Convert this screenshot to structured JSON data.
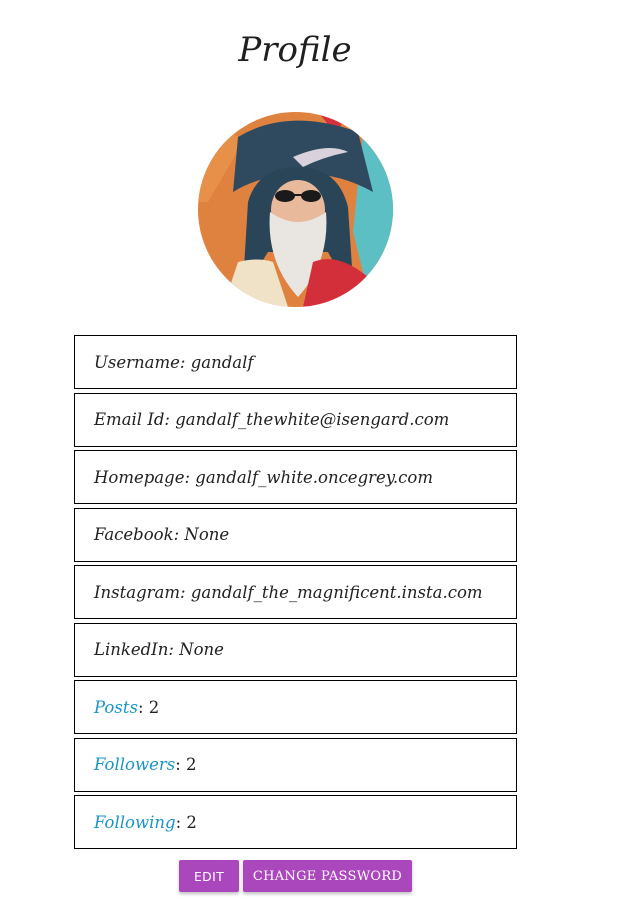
{
  "page": {
    "title": "Profile"
  },
  "avatar": {
    "alt": "gandalf avatar",
    "icon": "wizard-portrait"
  },
  "profile_fields": [
    {
      "label": "Username",
      "value": "gandalf"
    },
    {
      "label": "Email Id",
      "value": "gandalf_thewhite@isengard.com"
    },
    {
      "label": "Homepage",
      "value": "gandalf_white.oncegrey.com"
    },
    {
      "label": "Facebook",
      "value": "None"
    },
    {
      "label": "Instagram",
      "value": "gandalf_the_magnificent.insta.com"
    },
    {
      "label": "LinkedIn",
      "value": "None"
    }
  ],
  "stats": [
    {
      "label": "Posts",
      "value": "2"
    },
    {
      "label": "Followers",
      "value": "2"
    },
    {
      "label": "Following",
      "value": "2"
    }
  ],
  "actions": {
    "edit_label": "EDIT",
    "change_password_label": "CHANGE PASSWORD"
  },
  "colors": {
    "link": "#1a95c8",
    "button": "#ab47bc",
    "border": "#000000"
  }
}
